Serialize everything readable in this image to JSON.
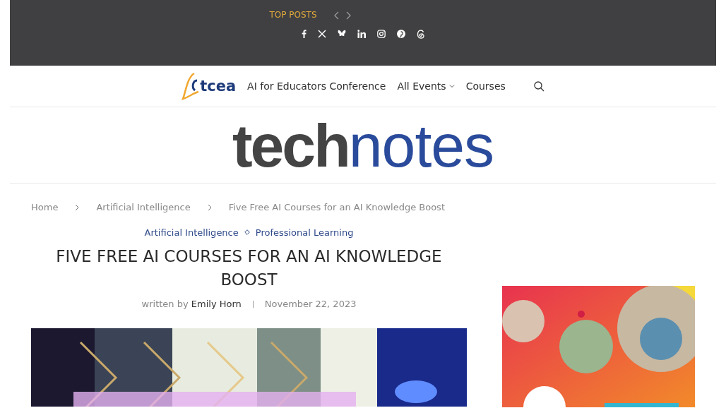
{
  "top_bar": {
    "label": "TOP POSTS"
  },
  "nav": {
    "logo_text": "tcea",
    "items": [
      {
        "label": "AI for Educators Conference",
        "has_dropdown": false
      },
      {
        "label": "All Events",
        "has_dropdown": true
      },
      {
        "label": "Courses",
        "has_dropdown": false
      }
    ]
  },
  "masthead": {
    "bold_part": "tech",
    "light_part": "notes"
  },
  "breadcrumb": [
    "Home",
    "Artificial Intelligence",
    "Five Free AI Courses for an AI Knowledge Boost"
  ],
  "article": {
    "categories": [
      "Artificial Intelligence",
      "Professional Learning"
    ],
    "title": "FIVE FREE AI COURSES FOR AN AI KNOWLEDGE BOOST",
    "byline_prefix": "written by",
    "author": "Emily Horn",
    "date": "November 22, 2023"
  }
}
